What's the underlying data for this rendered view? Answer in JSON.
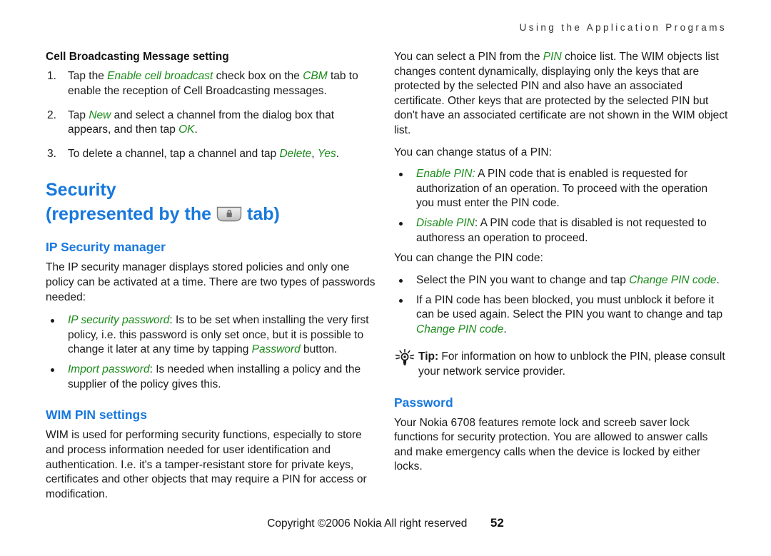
{
  "header": {
    "running_title": "Using the Application Programs"
  },
  "colors": {
    "heading_blue": "#1878dc",
    "emphasis_green": "#1a8a1a",
    "body_text": "#1a1a1a"
  },
  "left_column": {
    "cbm": {
      "heading": "Cell Broadcasting Message setting",
      "steps": [
        {
          "number": "1.",
          "parts": [
            {
              "text": "Tap the ",
              "style": "normal"
            },
            {
              "text": "Enable cell broadcast",
              "style": "green-italic"
            },
            {
              "text": " check box on the ",
              "style": "normal"
            },
            {
              "text": "CBM",
              "style": "green-italic"
            },
            {
              "text": " tab to enable the reception of Cell Broadcasting messages.",
              "style": "normal"
            }
          ]
        },
        {
          "number": "2.",
          "parts": [
            {
              "text": "Tap ",
              "style": "normal"
            },
            {
              "text": "New",
              "style": "green-italic"
            },
            {
              "text": " and select a channel from the dialog box that appears, and then tap ",
              "style": "normal"
            },
            {
              "text": "OK",
              "style": "green-italic"
            },
            {
              "text": ".",
              "style": "normal"
            }
          ]
        },
        {
          "number": "3.",
          "parts": [
            {
              "text": "To delete a channel, tap a channel and tap ",
              "style": "normal"
            },
            {
              "text": "Delete",
              "style": "green-italic"
            },
            {
              "text": ", ",
              "style": "normal"
            },
            {
              "text": "Yes",
              "style": "green-italic"
            },
            {
              "text": ".",
              "style": "normal"
            }
          ]
        }
      ]
    },
    "security": {
      "title": "Security",
      "represented_prefix": "(represented by the",
      "represented_suffix": "tab)",
      "tab_icon_name": "lock-tab-icon"
    },
    "ip_security_manager": {
      "heading": "IP Security manager",
      "intro": "The IP security manager displays stored policies and only one policy can be activated at a time. There are two types of passwords needed:",
      "bullets": [
        {
          "parts": [
            {
              "text": "IP security password",
              "style": "green-italic"
            },
            {
              "text": ": Is to be set when installing the very first policy, i.e. this password is only set once, but it is possible to change it later at any time by tapping ",
              "style": "normal"
            },
            {
              "text": "Password",
              "style": "green-italic"
            },
            {
              "text": " button.",
              "style": "normal"
            }
          ]
        },
        {
          "parts": [
            {
              "text": "Import password",
              "style": "green-italic"
            },
            {
              "text": ": Is needed when installing a policy and the supplier of the policy gives this.",
              "style": "normal"
            }
          ]
        }
      ]
    },
    "wim_pin_settings": {
      "heading": "WIM PIN settings",
      "body": "WIM is used for performing security functions, especially to store and process information needed for user identification and authentication. I.e. it's a tamper-resistant store for private keys, certificates and other objects that may require a PIN for access or modification."
    }
  },
  "right_column": {
    "pin_intro": {
      "parts": [
        {
          "text": "You can select a PIN from the ",
          "style": "normal"
        },
        {
          "text": "PIN",
          "style": "green-italic"
        },
        {
          "text": " choice list. The WIM objects list changes content dynamically, displaying only the keys that are protected by the selected PIN and also have an associated certificate. Other keys that are protected by the selected PIN but don't have an associated certificate are not shown in the WIM object list.",
          "style": "normal"
        }
      ]
    },
    "status_lead": "You can change status of a PIN:",
    "status_bullets": [
      {
        "parts": [
          {
            "text": "Enable PIN:",
            "style": "green-italic"
          },
          {
            "text": " A PIN code that is enabled is requested for authorization of an operation. To proceed with the operation you must enter the PIN code.",
            "style": "normal"
          }
        ]
      },
      {
        "parts": [
          {
            "text": "Disable PIN",
            "style": "green-italic"
          },
          {
            "text": ": A PIN code that is disabled is not requested to authoress an operation to proceed.",
            "style": "normal"
          }
        ]
      }
    ],
    "code_lead": "You can change the PIN code:",
    "code_bullets": [
      {
        "parts": [
          {
            "text": "Select the PIN you want to change and tap ",
            "style": "normal"
          },
          {
            "text": "Change PIN code",
            "style": "green-italic"
          },
          {
            "text": ".",
            "style": "normal"
          }
        ]
      },
      {
        "parts": [
          {
            "text": "If a PIN code has been blocked, you must unblock it before it can be used again. Select the PIN you want to change and tap ",
            "style": "normal"
          },
          {
            "text": "Change PIN code",
            "style": "green-italic"
          },
          {
            "text": ".",
            "style": "normal"
          }
        ]
      }
    ],
    "tip": {
      "icon_name": "lightbulb-tip-icon",
      "label": "Tip:",
      "text": " For information on how to unblock the PIN, please consult your network service provider."
    },
    "password": {
      "heading": "Password",
      "body": "Your Nokia 6708 features remote lock and screeb saver lock functions for security protection. You are allowed to answer calls and make emergency calls when the device is locked by either locks."
    }
  },
  "footer": {
    "copyright": "Copyright ©2006 Nokia All right reserved",
    "page_number": "52"
  }
}
